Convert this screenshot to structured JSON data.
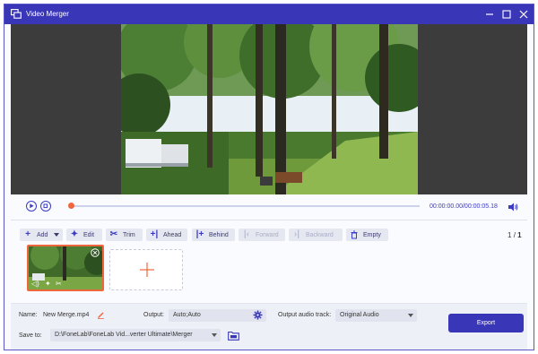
{
  "window": {
    "title": "Video Merger",
    "accent": "#3a36b8",
    "highlight": "#f0663c"
  },
  "player": {
    "time_display": "00:00:00.00/00:00:05.18",
    "progress": 0.0
  },
  "toolbar": {
    "add_label": "Add",
    "edit_label": "Edit",
    "trim_label": "Trim",
    "ahead_label": "Ahead",
    "behind_label": "Behind",
    "forward_label": "Forward",
    "backward_label": "Backward",
    "empty_label": "Empty",
    "page_current": "1",
    "page_sep": "/",
    "page_total": "1"
  },
  "clips": [
    {
      "selected": true,
      "thumb": "green-park"
    }
  ],
  "bottom": {
    "name_label": "Name:",
    "name_value": "New Merge.mp4",
    "output_label": "Output:",
    "output_value": "Auto;Auto",
    "audio_label": "Output audio track:",
    "audio_value": "Original Audio",
    "save_label": "Save to:",
    "save_path": "D:\\FoneLab\\FoneLab Vid...verter Ultimate\\Merger",
    "export_label": "Export"
  }
}
